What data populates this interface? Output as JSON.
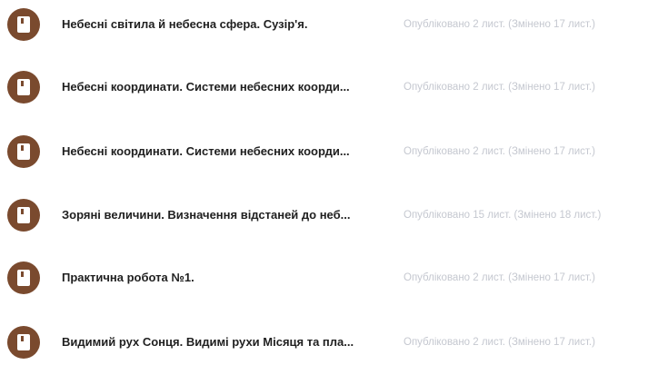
{
  "accent_color": "#7a4a2e",
  "items": [
    {
      "icon": "assignment-icon",
      "title": "Небесні світила й небесна сфера. Сузір'я.",
      "meta": "Опубліковано 2 лист. (Змінено 17 лист.)"
    },
    {
      "icon": "assignment-icon",
      "title": "Небесні координати. Системи небесних коорди...",
      "meta": "Опубліковано 2 лист. (Змінено 17 лист.)"
    },
    {
      "icon": "assignment-icon",
      "title": "Небесні координати. Системи небесних коорди...",
      "meta": "Опубліковано 2 лист. (Змінено 17 лист.)"
    },
    {
      "icon": "assignment-icon",
      "title": "Зоряні величини. Визначення відстаней до неб...",
      "meta": "Опубліковано 15 лист. (Змінено 18 лист.)"
    },
    {
      "icon": "assignment-icon",
      "title": "Практична робота №1.",
      "meta": "Опубліковано 2 лист. (Змінено 17 лист.)"
    },
    {
      "icon": "assignment-icon",
      "title": "Видимий рух Сонця. Видимі рухи Місяця та пла...",
      "meta": "Опубліковано 2 лист. (Змінено 17 лист.)"
    }
  ]
}
